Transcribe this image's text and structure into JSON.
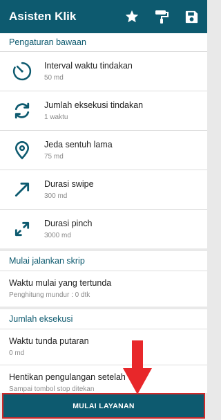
{
  "appbar": {
    "title": "Asisten Klik",
    "icons": [
      "star-icon",
      "paint-roller-icon",
      "save-icon"
    ]
  },
  "sections": {
    "default_settings": {
      "header": "Pengaturan bawaan",
      "items": [
        {
          "label": "Interval waktu tindakan",
          "value": "50 md",
          "icon": "timer-icon"
        },
        {
          "label": "Jumlah eksekusi tindakan",
          "value": "1 waktu",
          "icon": "repeat-icon"
        },
        {
          "label": "Jeda sentuh lama",
          "value": "75 md",
          "icon": "location-pin-icon"
        },
        {
          "label": "Durasi swipe",
          "value": "300 md",
          "icon": "diagonal-arrow-icon"
        },
        {
          "label": "Durasi pinch",
          "value": "3000 md",
          "icon": "pinch-arrows-icon"
        }
      ]
    },
    "run_script": {
      "header": "Mulai jalankan skrip",
      "items": [
        {
          "label": "Waktu mulai yang tertunda",
          "value": "Penghitung mundur : 0 dtk"
        }
      ]
    },
    "execution_count": {
      "header": "Jumlah eksekusi",
      "items": [
        {
          "label": "Waktu tunda putaran",
          "value": "0 md"
        },
        {
          "label": "Hentikan pengulangan setelah",
          "value": "Sampai tombol stop ditekan"
        }
      ]
    }
  },
  "footer": {
    "start_service_label": "MULAI LAYANAN"
  },
  "colors": {
    "primary": "#0d5a6f",
    "highlight": "#cf2a2a"
  }
}
